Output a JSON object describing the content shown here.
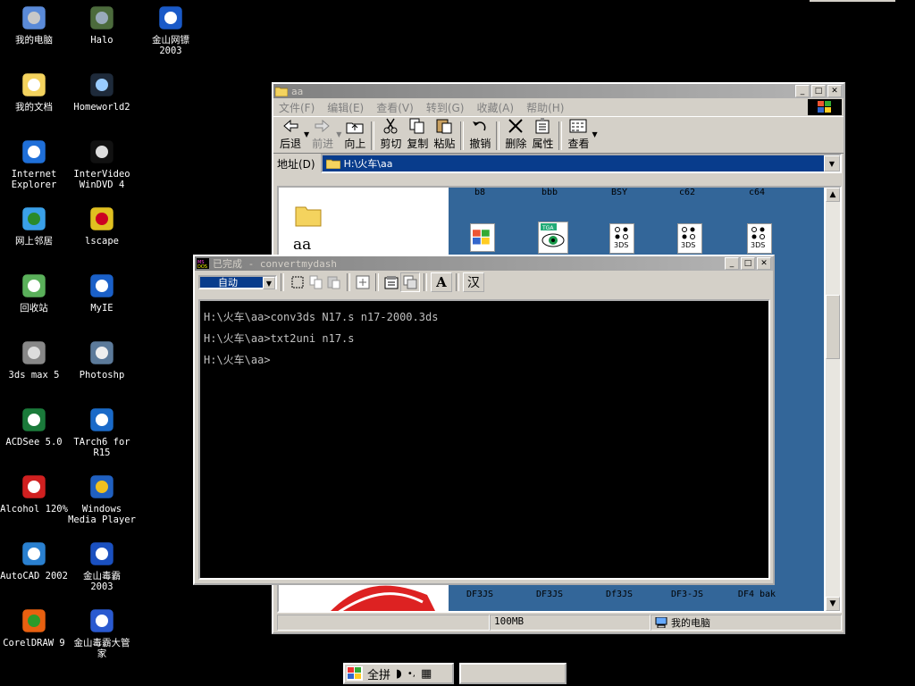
{
  "desktop": {
    "icons": [
      {
        "label": "我的电脑",
        "icon": "my-computer-icon"
      },
      {
        "label": "Halo",
        "icon": "halo-icon"
      },
      {
        "label": "金山网镖\n2003",
        "icon": "jinshan-wangbiao-icon"
      },
      {
        "label": "我的文档",
        "icon": "my-documents-icon"
      },
      {
        "label": "Homeworld2",
        "icon": "homeworld2-icon"
      },
      {
        "label": "Internet\nExplorer",
        "icon": "internet-explorer-icon"
      },
      {
        "label": "InterVideo\nWinDVD 4",
        "icon": "windvd-icon"
      },
      {
        "label": "网上邻居",
        "icon": "network-neighborhood-icon"
      },
      {
        "label": "lscape",
        "icon": "lscape-icon"
      },
      {
        "label": "回收站",
        "icon": "recycle-bin-icon"
      },
      {
        "label": "MyIE",
        "icon": "myie-icon"
      },
      {
        "label": "3ds max 5",
        "icon": "3dsmax-icon"
      },
      {
        "label": "Photoshp",
        "icon": "photoshop-icon"
      },
      {
        "label": "ACDSee 5.0",
        "icon": "acdsee-icon"
      },
      {
        "label": "TArch6 for\nR15",
        "icon": "tarch-icon"
      },
      {
        "label": "Alcohol 120%",
        "icon": "alcohol-icon"
      },
      {
        "label": "Windows\nMedia Player",
        "icon": "media-player-icon"
      },
      {
        "label": "AutoCAD 2002",
        "icon": "autocad-icon"
      },
      {
        "label": "金山毒霸\n2003",
        "icon": "jinshan-duba-icon"
      },
      {
        "label": "CorelDRAW 9",
        "icon": "coreldraw-icon"
      },
      {
        "label": "金山毒霸大管\n家",
        "icon": "duba-manager-icon"
      }
    ]
  },
  "explorer": {
    "title": "aa",
    "menu": [
      "文件(F)",
      "编辑(E)",
      "查看(V)",
      "转到(G)",
      "收藏(A)",
      "帮助(H)"
    ],
    "toolbar": [
      {
        "label": "后退",
        "icon": "back-icon",
        "enabled": true
      },
      {
        "label": "前进",
        "icon": "forward-icon",
        "enabled": false
      },
      {
        "label": "向上",
        "icon": "up-folder-icon",
        "enabled": true
      },
      {
        "label": "剪切",
        "icon": "cut-icon",
        "enabled": true
      },
      {
        "label": "复制",
        "icon": "copy-icon",
        "enabled": true
      },
      {
        "label": "粘贴",
        "icon": "paste-icon",
        "enabled": true
      },
      {
        "label": "撤销",
        "icon": "undo-icon",
        "enabled": true
      },
      {
        "label": "删除",
        "icon": "delete-icon",
        "enabled": true
      },
      {
        "label": "属性",
        "icon": "properties-icon",
        "enabled": true
      },
      {
        "label": "查看",
        "icon": "views-icon",
        "enabled": true
      }
    ],
    "address_label": "地址(D)",
    "address_value": "H:\\火车\\aa",
    "folder_name": "aa",
    "top_files": [
      "b8",
      "bbb",
      "BSY",
      "c62",
      "c64"
    ],
    "bottom_files": [
      "DF3JS",
      "DF3JS",
      "Df3JS",
      "DF3-JS",
      "DF4 bak"
    ],
    "status_size": "100MB",
    "status_location": "我的电脑"
  },
  "console": {
    "title": "已完成 - convertmydash",
    "font_select": "自动",
    "lines": [
      "H:\\火车\\aa>conv3ds N17.s n17-2000.3ds",
      "H:\\火车\\aa>txt2uni n17.s",
      "H:\\火车\\aa>"
    ],
    "ime_button": "汉"
  },
  "ime_bar": {
    "mode": "全拼"
  },
  "colors": {
    "desktop": "#000000",
    "folder_pane": "#336699",
    "title_inactive": "#808080",
    "title_active": "#0a246a"
  }
}
